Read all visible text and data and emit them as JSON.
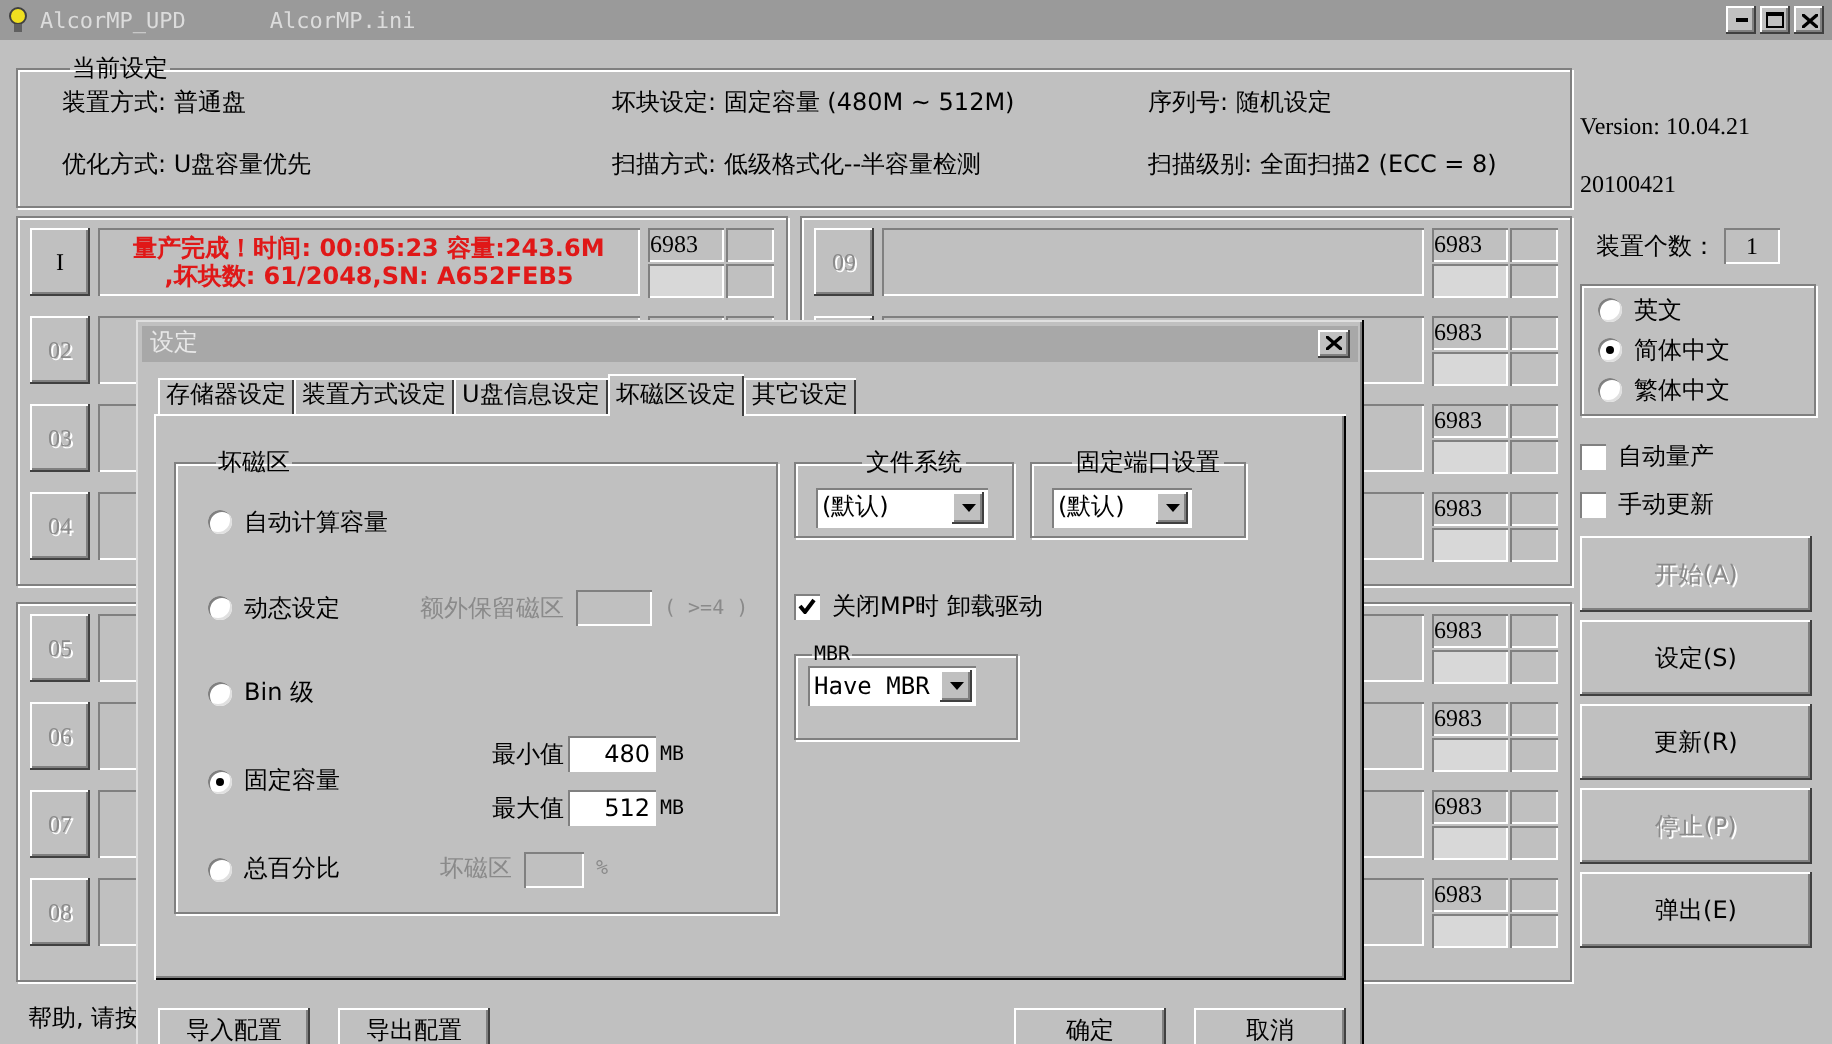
{
  "window": {
    "title": "AlcorMP_UPD",
    "ini": "AlcorMP.ini"
  },
  "current_settings": {
    "title": "当前设定",
    "items": [
      "装置方式: 普通盘",
      "坏块设定: 固定容量 (480M ~ 512M)",
      "序列号: 随机设定",
      "优化方式: U盘容量优先",
      "扫描方式: 低级格式化--半容量检测",
      "扫描级别: 全面扫描2 (ECC = 8)"
    ]
  },
  "port_groups": [
    {
      "left": [
        {
          "label": "I",
          "disabled": false,
          "status": [
            "量产完成！时间: 00:05:23 容量:243.6M",
            ",坏块数: 61/2048,SN: A652FEB5"
          ],
          "code": "6983"
        },
        {
          "label": "02",
          "disabled": true
        },
        {
          "label": "03",
          "disabled": true
        },
        {
          "label": "04",
          "disabled": true
        }
      ],
      "right": [
        {
          "label": "09",
          "disabled": true,
          "code": "6983"
        },
        {
          "code": "6983"
        },
        {
          "code": "6983"
        },
        {
          "code": "6983"
        }
      ]
    },
    {
      "left": [
        {
          "label": "05",
          "disabled": true
        },
        {
          "label": "06",
          "disabled": true
        },
        {
          "label": "07",
          "disabled": true
        },
        {
          "label": "08",
          "disabled": true
        }
      ],
      "right": [
        {
          "code": "6983"
        },
        {
          "code": "6983"
        },
        {
          "code": "6983"
        },
        {
          "code": "6983"
        }
      ]
    }
  ],
  "status_bar": "帮助, 请按",
  "side": {
    "version": "Version: 10.04.21",
    "date": "20100421",
    "device_count": {
      "label": "装置个数：",
      "value": "1"
    },
    "languages": [
      {
        "label": "英文",
        "selected": false
      },
      {
        "label": "简体中文",
        "selected": true
      },
      {
        "label": "繁体中文",
        "selected": false
      }
    ],
    "checkboxes": [
      {
        "label": "自动量产",
        "checked": false
      },
      {
        "label": "手动更新",
        "checked": false
      }
    ],
    "buttons": [
      {
        "label": "开始(A)",
        "disabled": true
      },
      {
        "label": "设定(S)",
        "disabled": false
      },
      {
        "label": "更新(R)",
        "disabled": false
      },
      {
        "label": "停止(P)",
        "disabled": true
      },
      {
        "label": "弹出(E)",
        "disabled": false
      }
    ]
  },
  "dialog": {
    "title": "设定",
    "tabs": [
      {
        "label": "存储器设定",
        "selected": false
      },
      {
        "label": "装置方式设定",
        "selected": false
      },
      {
        "label": "U盘信息设定",
        "selected": false
      },
      {
        "label": "坏磁区设定",
        "selected": true
      },
      {
        "label": "其它设定",
        "selected": false
      }
    ],
    "bad_sector": {
      "title": "坏磁区",
      "options": [
        {
          "kind": "plain",
          "label": "自动计算容量",
          "selected": false
        },
        {
          "kind": "reserve",
          "label": "动态设定",
          "selected": false,
          "extra_label": "额外保留磁区",
          "hint": "( >=4 )"
        },
        {
          "kind": "plain",
          "label": "Bin 级",
          "selected": false
        },
        {
          "kind": "range",
          "label": "固定容量",
          "selected": true,
          "min_label": "最小值",
          "min_value": "480",
          "min_unit": "MB",
          "max_label": "最大值",
          "max_value": "512",
          "max_unit": "MB"
        },
        {
          "kind": "percent",
          "label": "总百分比",
          "selected": false,
          "extra_label": "坏磁区",
          "unit": "%"
        }
      ]
    },
    "file_system": {
      "title": "文件系统",
      "value": "(默认)"
    },
    "fixed_port": {
      "title": "固定端口设置",
      "value": "(默认)"
    },
    "unload_driver": {
      "label": "关闭MP时 卸载驱动",
      "checked": true
    },
    "mbr": {
      "title": "MBR",
      "value": "Have MBR"
    },
    "left_buttons": [
      "导入配置",
      "导出配置"
    ],
    "right_buttons": [
      "确定",
      "取消"
    ]
  }
}
